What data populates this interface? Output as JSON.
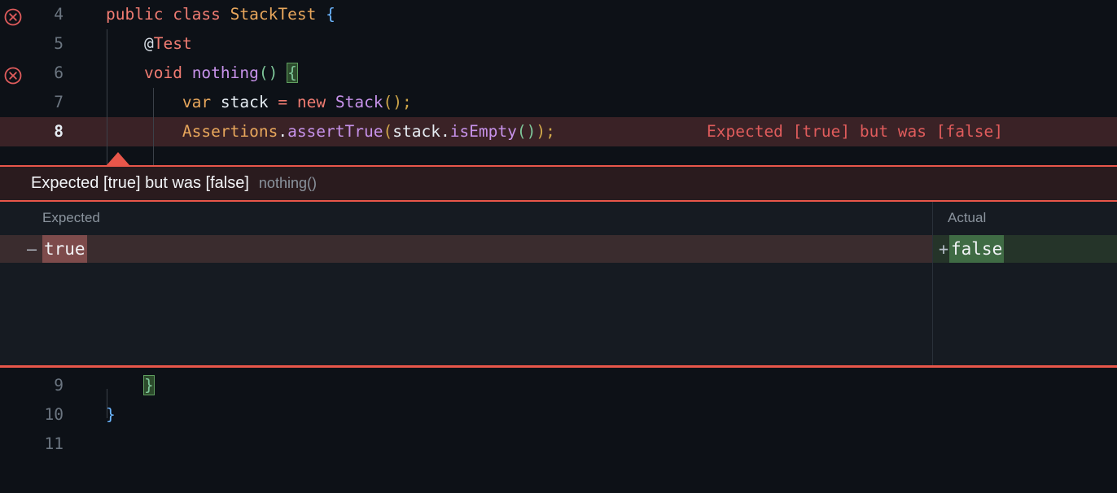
{
  "editor": {
    "top_lines": [
      {
        "number": "4",
        "has_error_icon": true,
        "current": false,
        "highlighted": false,
        "tokens": [
          {
            "text": "public",
            "cls": "t-kw"
          },
          {
            "text": " ",
            "cls": "t-plain"
          },
          {
            "text": "class",
            "cls": "t-kw"
          },
          {
            "text": " ",
            "cls": "t-plain"
          },
          {
            "text": "StackTest",
            "cls": "t-cls"
          },
          {
            "text": " ",
            "cls": "t-plain"
          },
          {
            "text": "{",
            "cls": "t-punc-blue"
          }
        ]
      },
      {
        "number": "5",
        "has_error_icon": false,
        "current": false,
        "highlighted": false,
        "tokens": [
          {
            "text": "    ",
            "cls": "t-plain"
          },
          {
            "text": "@",
            "cls": "t-at"
          },
          {
            "text": "Test",
            "cls": "t-kw"
          }
        ]
      },
      {
        "number": "6",
        "has_error_icon": true,
        "current": false,
        "highlighted": false,
        "tokens": [
          {
            "text": "    ",
            "cls": "t-plain"
          },
          {
            "text": "void",
            "cls": "t-kw"
          },
          {
            "text": " ",
            "cls": "t-plain"
          },
          {
            "text": "nothing",
            "cls": "t-meth"
          },
          {
            "text": "()",
            "cls": "t-punc-green"
          },
          {
            "text": " ",
            "cls": "t-plain"
          },
          {
            "text": "{",
            "cls": "t-brace-match"
          }
        ]
      },
      {
        "number": "7",
        "has_error_icon": false,
        "current": false,
        "highlighted": false,
        "tokens": [
          {
            "text": "        ",
            "cls": "t-plain"
          },
          {
            "text": "var",
            "cls": "t-type"
          },
          {
            "text": " ",
            "cls": "t-plain"
          },
          {
            "text": "stack",
            "cls": "t-var"
          },
          {
            "text": " ",
            "cls": "t-plain"
          },
          {
            "text": "=",
            "cls": "t-kw"
          },
          {
            "text": " ",
            "cls": "t-plain"
          },
          {
            "text": "new",
            "cls": "t-kw"
          },
          {
            "text": " ",
            "cls": "t-plain"
          },
          {
            "text": "Stack",
            "cls": "t-meth"
          },
          {
            "text": "()",
            "cls": "t-punc-yellow"
          },
          {
            "text": ";",
            "cls": "t-punc-yellow"
          }
        ]
      },
      {
        "number": "8",
        "has_error_icon": false,
        "current": true,
        "highlighted": true,
        "tokens": [
          {
            "text": "        ",
            "cls": "t-plain"
          },
          {
            "text": "Assertions",
            "cls": "t-cls"
          },
          {
            "text": ".",
            "cls": "t-plain"
          },
          {
            "text": "assertTrue",
            "cls": "t-meth"
          },
          {
            "text": "(",
            "cls": "t-punc-yellow"
          },
          {
            "text": "stack",
            "cls": "t-var"
          },
          {
            "text": ".",
            "cls": "t-plain"
          },
          {
            "text": "isEmpty",
            "cls": "t-meth"
          },
          {
            "text": "()",
            "cls": "t-punc-green"
          },
          {
            "text": ")",
            "cls": "t-punc-yellow"
          },
          {
            "text": ";",
            "cls": "t-punc-yellow"
          }
        ],
        "inline_error": "Expected [true] but was [false]"
      }
    ],
    "bottom_lines": [
      {
        "number": "9",
        "has_error_icon": false,
        "current": false,
        "highlighted": false,
        "tokens": [
          {
            "text": "    ",
            "cls": "t-plain"
          },
          {
            "text": "}",
            "cls": "t-brace-match"
          }
        ]
      },
      {
        "number": "10",
        "has_error_icon": false,
        "current": false,
        "highlighted": false,
        "tokens": [
          {
            "text": "}",
            "cls": "t-punc-blue"
          }
        ]
      },
      {
        "number": "11",
        "has_error_icon": false,
        "current": false,
        "highlighted": false,
        "tokens": []
      }
    ]
  },
  "banner": {
    "title": "Expected [true] but was [false]",
    "subtitle": "nothing()"
  },
  "diff": {
    "expected_label": "Expected",
    "actual_label": "Actual",
    "expected_value": "true",
    "actual_value": "false",
    "minus_marker": "—",
    "plus_marker": "+"
  },
  "colors": {
    "background": "#0d1117",
    "error_red": "#e8564a",
    "removed_bg": "#3a2c2e",
    "removed_highlight": "#7d4b4b",
    "added_bg": "#253429",
    "added_highlight": "#3f6b44",
    "banner_bg": "#2a1b1e",
    "current_line_bg": "#3a2226",
    "diff_panel_bg": "#161b22"
  },
  "icons": {
    "error_gutter": "circle-x-error-icon"
  }
}
